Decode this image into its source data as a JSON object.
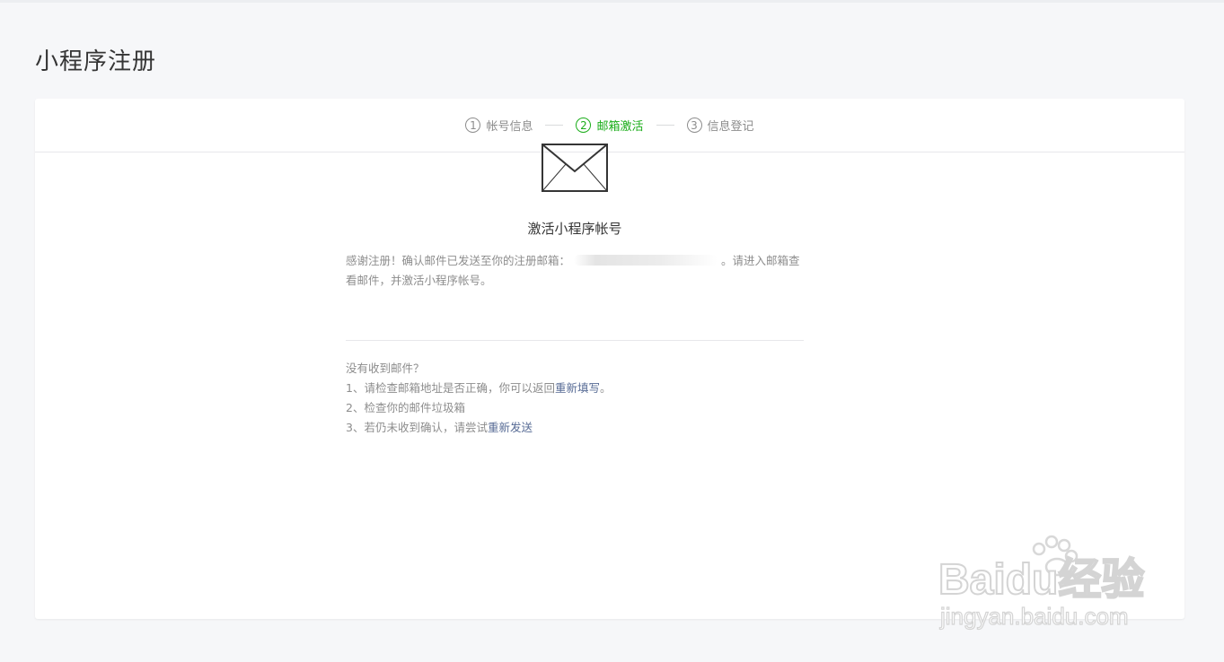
{
  "page": {
    "title": "小程序注册"
  },
  "steps": [
    {
      "num": "1",
      "label": "帐号信息"
    },
    {
      "num": "2",
      "label": "邮箱激活"
    },
    {
      "num": "3",
      "label": "信息登记"
    }
  ],
  "activation": {
    "icon": "mail-icon",
    "title": "激活小程序帐号",
    "desc_before": "感谢注册！确认邮件已发送至你的注册邮箱：",
    "desc_after": "。请进入邮箱查看邮件，并激活小程序帐号。"
  },
  "help": {
    "heading": "没有收到邮件？",
    "tip1_prefix": "1、请检查邮箱地址是否正确，你可以返回",
    "tip1_link": "重新填写",
    "tip1_suffix": "。",
    "tip2": "2、检查你的邮件垃圾箱",
    "tip3_prefix": "3、若仍未收到确认，请尝试",
    "tip3_link": "重新发送"
  },
  "watermark": {
    "logo": "Baidu经验",
    "url": "jingyan.baidu.com"
  },
  "colors": {
    "accent": "#1aad19",
    "link": "#576b95",
    "muted": "#8d8d8d"
  }
}
